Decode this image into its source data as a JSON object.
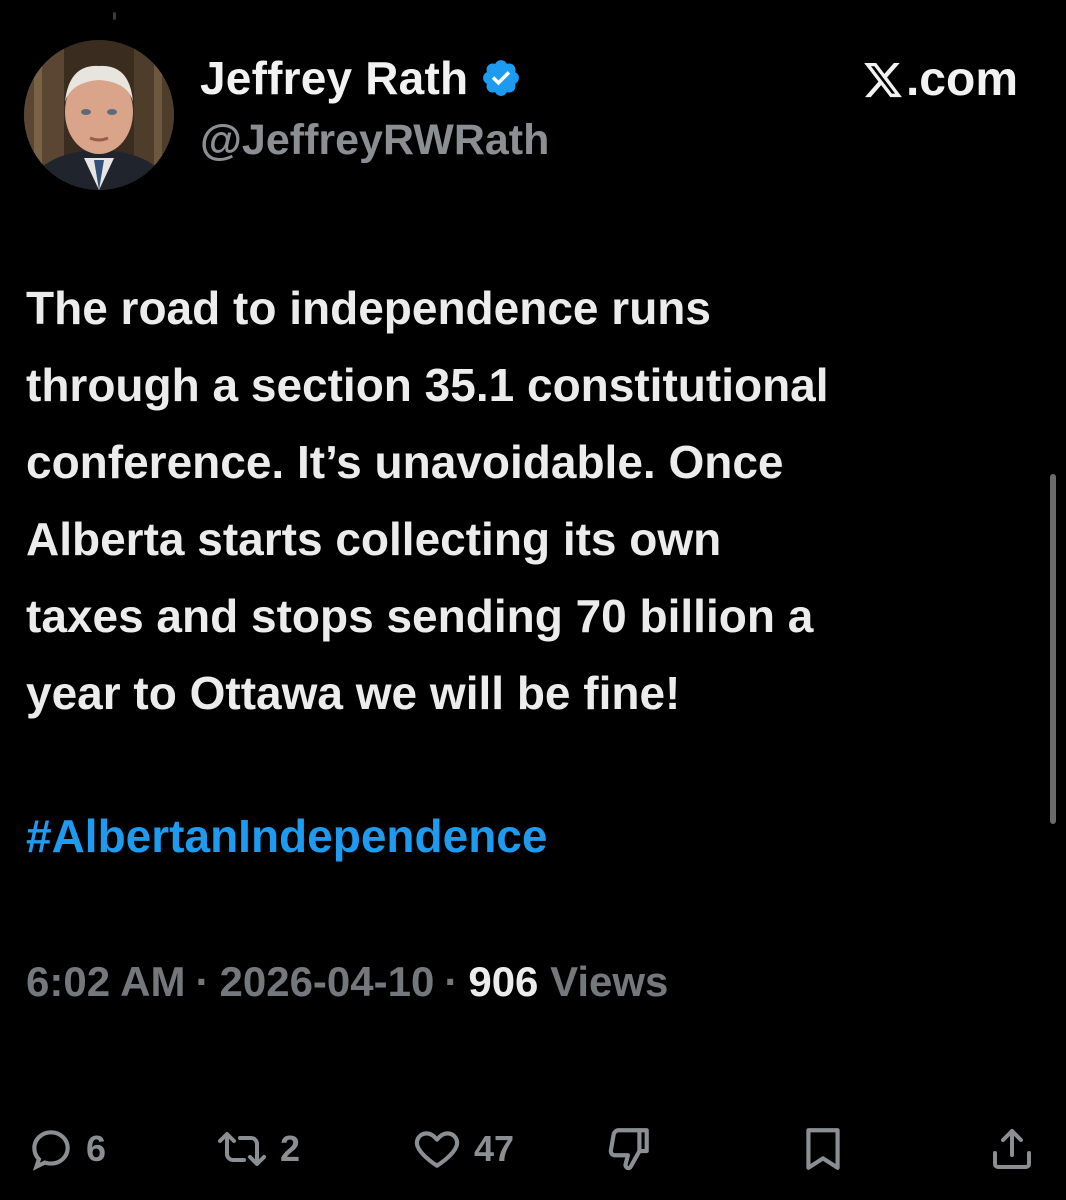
{
  "author": {
    "display_name": "Jeffrey Rath",
    "handle": "@JeffreyRWRath",
    "verified": true,
    "verified_color": "#1d9bf0"
  },
  "brand": {
    "label": ".com",
    "icon": "x-logo-icon"
  },
  "tweet": {
    "lines": [
      "The road to independence runs",
      "through a section 35.1 constitutional",
      "conference. It’s unavoidable. Once",
      "Alberta starts collecting its own",
      "taxes and stops sending 70 billion a",
      "year to Ottawa we will be fine!"
    ],
    "hashtag": "#AlbertanIndependence",
    "hashtag_color": "#1d9bf0"
  },
  "meta": {
    "time": "6:02 AM",
    "separator": "·",
    "date": "2026-04-10",
    "views_count": "906",
    "views_label": "Views"
  },
  "actions": {
    "reply": {
      "icon": "reply-icon",
      "count": "6"
    },
    "repost": {
      "icon": "repost-icon",
      "count": "2"
    },
    "like": {
      "icon": "heart-icon",
      "count": "47"
    },
    "dislike": {
      "icon": "thumbs-down-icon"
    },
    "bookmark": {
      "icon": "bookmark-icon"
    },
    "share": {
      "icon": "share-icon"
    }
  }
}
